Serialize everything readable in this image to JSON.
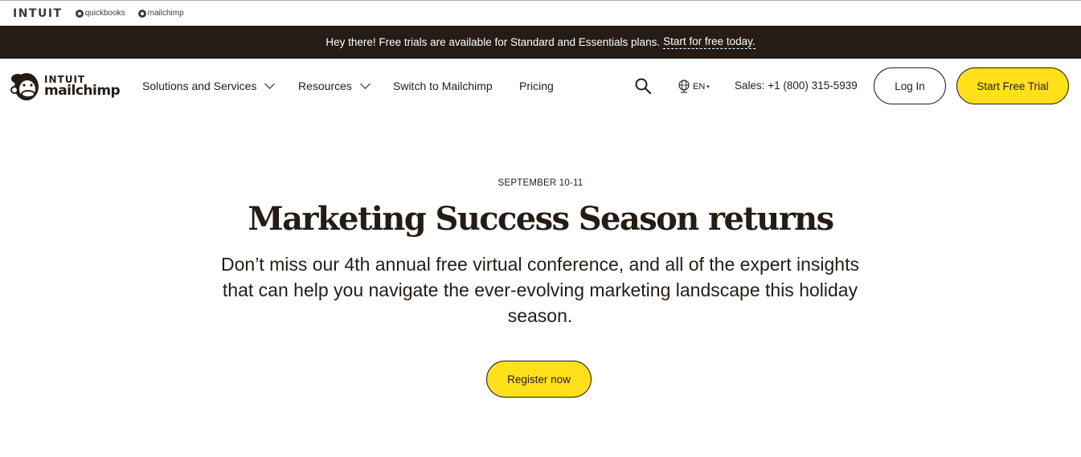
{
  "brand_bar": {
    "intuit": "INTUIT",
    "items": [
      {
        "label": "quickbooks",
        "icon": "quickbooks-icon"
      },
      {
        "label": "mailchimp",
        "icon": "mailchimp-icon"
      }
    ]
  },
  "banner": {
    "text": "Hey there! Free trials are available for Standard and Essentials plans.",
    "link": "Start for free today."
  },
  "nav": {
    "logo": {
      "line1": "INTUIT",
      "line2": "mailchimp"
    },
    "items": [
      {
        "label": "Solutions and Services",
        "has_dropdown": true
      },
      {
        "label": "Resources",
        "has_dropdown": true
      },
      {
        "label": "Switch to Mailchimp",
        "has_dropdown": false
      },
      {
        "label": "Pricing",
        "has_dropdown": false
      }
    ],
    "language": "EN",
    "sales": "Sales: +1 (800) 315-5939",
    "login": "Log In",
    "trial": "Start Free Trial"
  },
  "hero": {
    "eyebrow": "SEPTEMBER 10-11",
    "headline": "Marketing Success Season returns",
    "subtext": "Don’t miss our 4th annual free virtual conference, and all of the expert insights that can help you navigate the ever-evolving marketing landscape this holiday season.",
    "cta": "Register now"
  },
  "colors": {
    "brand_yellow": "#ffe01b",
    "dark": "#241c15",
    "white": "#ffffff"
  }
}
